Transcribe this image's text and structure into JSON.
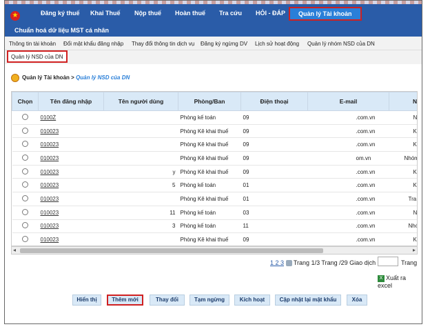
{
  "nav": {
    "menus": [
      "Đăng ký thuế",
      "Khai Thuế",
      "Nộp thuế",
      "Hoàn thuế",
      "Tra cứu",
      "HỎI - ĐÁP",
      "Quản lý Tài khoản"
    ],
    "subtitle": "Chuẩn hoá dữ liệu MST cá nhân"
  },
  "tabs": [
    "Thông tin tài khoản",
    "Đổi mật khẩu đăng nhập",
    "Thay đổi thông tin dịch vụ",
    "Đăng ký ngừng DV",
    "Lịch sử hoạt động",
    "Quản lý nhóm NSD của DN"
  ],
  "active_tab": "Quản lý NSD của DN",
  "breadcrumb": {
    "root": "Quản lý Tài khoản",
    "sep": " > ",
    "current": "Quản lý NSD của DN"
  },
  "table": {
    "headers": [
      "Chọn",
      "Tên đăng nhập",
      "Tên người dùng",
      "Phòng/Ban",
      "Điện thoại",
      "E-mail",
      "Nhóm"
    ],
    "rows": [
      {
        "login": "0100Ż",
        "name": "",
        "dept": "Phòng kế toán",
        "phone": "09",
        "email": ".com.vn",
        "group": "Nộp t"
      },
      {
        "login": "010023",
        "name": "",
        "dept": "Phòng Kê khai thuế",
        "phone": "09",
        "email": ".com.vn",
        "group": "Kê k"
      },
      {
        "login": "010023",
        "name": "",
        "dept": "Phòng Kê khai thuế",
        "phone": "09",
        "email": ".com.vn",
        "group": "Kê k"
      },
      {
        "login": "010023",
        "name": "",
        "dept": "Phòng Kê khai thuế",
        "phone": "09",
        "email": "om.vn",
        "group": "Nhóm ng"
      },
      {
        "login": "010023",
        "name": "y",
        "dept": "Phòng Kê khai thuế",
        "phone": "09",
        "email": ".com.vn",
        "group": "Kê k"
      },
      {
        "login": "010023",
        "name": "5",
        "dept": "Phòng kế toán",
        "phone": "01",
        "email": ".com.vn",
        "group": "Kê k"
      },
      {
        "login": "010023",
        "name": "",
        "dept": "Phòng Kê khai thuế",
        "phone": "01",
        "email": ".com.vn",
        "group": "Tra cứu t"
      },
      {
        "login": "010023",
        "name": "11",
        "dept": "Phòng kế toán",
        "phone": "03",
        "email": ".com.vn",
        "group": "Nộp t"
      },
      {
        "login": "010023",
        "name": "3",
        "dept": "Phòng kế toán",
        "phone": "11",
        "email": ".com.vn",
        "group": "Nhóm k"
      },
      {
        "login": "010023",
        "name": "",
        "dept": "Phòng Kê khai thuế",
        "phone": "09",
        "email": ".com.vn",
        "group": "Kê k"
      }
    ]
  },
  "pager": {
    "pages": "1 2 3",
    "summary": "Trang 1/3 Trang /29 Giao dịch",
    "go_label": "Trang"
  },
  "export_label": "Xuất ra excel",
  "buttons": [
    "Hiển thị",
    "Thêm mới",
    "Thay đổi",
    "Tạm ngừng",
    "Kích hoạt",
    "Cập nhật lại mật khẩu",
    "Xóa"
  ]
}
